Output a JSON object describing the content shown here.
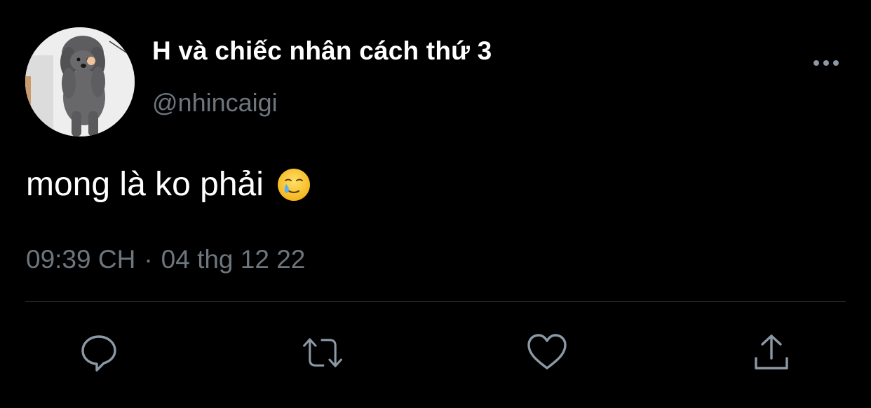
{
  "tweet": {
    "display_name": "H và chiếc nhân cách thứ 3",
    "handle": "@nhincaigi",
    "text": "mong là ko phải",
    "emoji": "face-holding-back-tears",
    "time": "09:39 CH",
    "separator": "·",
    "date": "04 thg 12 22"
  },
  "actions": {
    "reply": "reply-icon",
    "retweet": "retweet-icon",
    "like": "heart-icon",
    "share": "share-icon"
  },
  "colors": {
    "background": "#000000",
    "primary_text": "#ffffff",
    "secondary_text": "#6e767d",
    "icon": "#8b98a5",
    "divider": "#2f3336"
  }
}
